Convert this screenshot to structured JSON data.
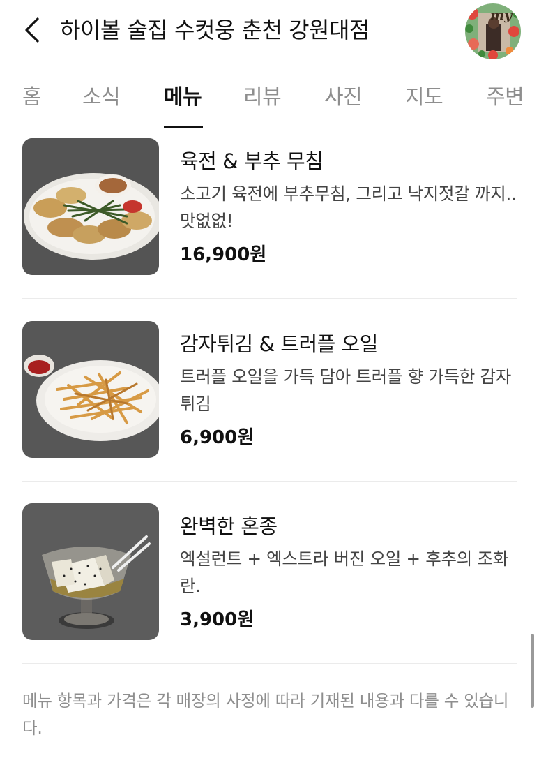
{
  "header": {
    "title": "하이볼 술집 수컷웅 춘천 강원대점",
    "back_icon": "chevron-left-icon",
    "avatar_tag": "my"
  },
  "tabs": [
    {
      "label": "홈",
      "active": false
    },
    {
      "label": "소식",
      "active": false
    },
    {
      "label": "메뉴",
      "active": true
    },
    {
      "label": "리뷰",
      "active": false
    },
    {
      "label": "사진",
      "active": false
    },
    {
      "label": "지도",
      "active": false
    },
    {
      "label": "주변",
      "active": false
    }
  ],
  "menu": [
    {
      "name": "육전 & 부추 무침",
      "desc": "소고기 육전에 부추무침, 그리고 낙지젓갈 까지.. 맛없없!",
      "price": "16,900원"
    },
    {
      "name": "감자튀김 & 트러플 오일",
      "desc": "트러플 오일을 가득 담아 트러플 향 가득한 감자튀김",
      "price": "6,900원"
    },
    {
      "name": "완벽한 혼종",
      "desc": "엑설런트 + 엑스트라 버진 오일 + 후추의 조화란.",
      "price": "3,900원"
    }
  ],
  "notice": "메뉴 항목과 가격은 각 매장의 사정에 따라 기재된 내용과 다를 수 있습니다.",
  "colors": {
    "text_primary": "#111111",
    "text_secondary": "#444444",
    "text_muted": "#8e8e8e",
    "divider": "#ebebeb"
  }
}
